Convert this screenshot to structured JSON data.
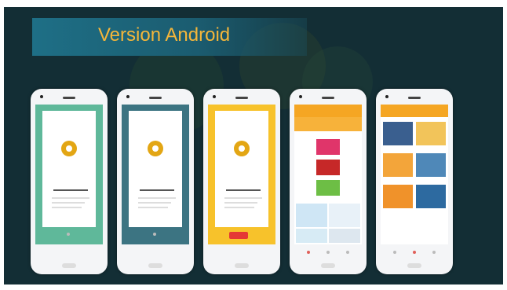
{
  "slide": {
    "title": "Version Android"
  },
  "colors": {
    "teal": "#5fb89a",
    "slate": "#3c7482",
    "yellow": "#f7c22b",
    "orange": "#f5a623",
    "red": "#e53935"
  }
}
